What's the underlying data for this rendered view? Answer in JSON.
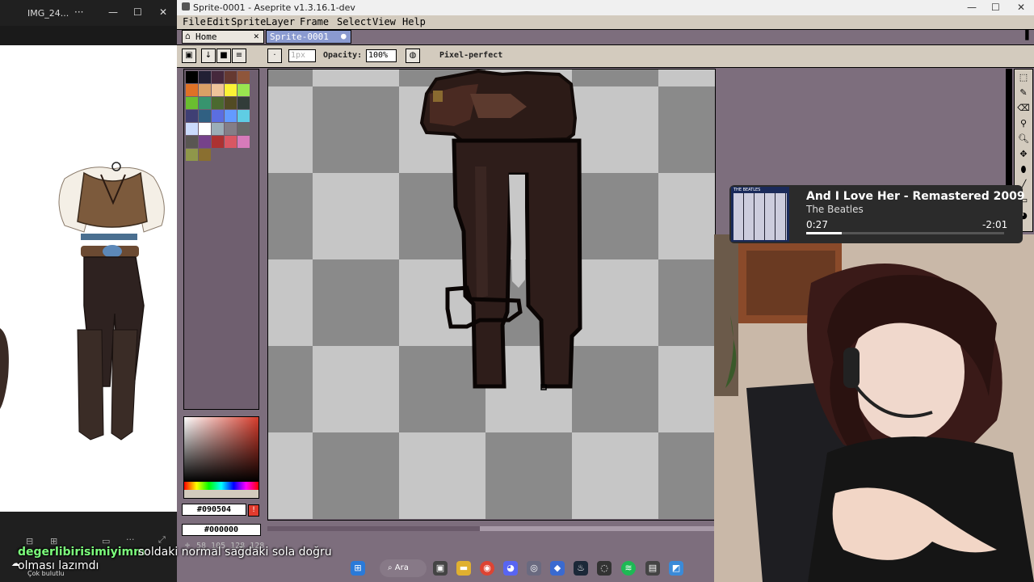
{
  "viewer": {
    "title": "IMG_24...",
    "more": "···",
    "minimize": "—",
    "maximize": "☐",
    "close": "✕"
  },
  "aseprite": {
    "window_title": "Sprite-0001 - Aseprite v1.3.16.1-dev",
    "menu": [
      "File",
      "Edit",
      "Sprite",
      "Layer",
      "Frame",
      "Select",
      "View",
      "Help"
    ],
    "tabs": {
      "home": "Home",
      "sprite": "Sprite-0001"
    },
    "toolbar": {
      "opacity_label": "Opacity:",
      "opacity_value": "100%",
      "brush_size": "1px",
      "pixel_perfect": "Pixel-perfect"
    },
    "palette_colors": [
      "#000000",
      "#222034",
      "#45283c",
      "#663931",
      "#8f563b",
      "#df7126",
      "#d9a066",
      "#eec39a",
      "#fbf236",
      "#99e550",
      "#6abe30",
      "#37946e",
      "#4b692f",
      "#524b24",
      "#323c39",
      "#3f3f74",
      "#306082",
      "#5b6ee1",
      "#639bff",
      "#5fcde4",
      "#cbdbfc",
      "#ffffff",
      "#9badb7",
      "#847e87",
      "#696a6a",
      "#595652",
      "#76428a",
      "#ac3232",
      "#d95763",
      "#d77bba",
      "#8f974a",
      "#8a6f30"
    ],
    "fg_hex": "#090504",
    "bg_hex": "#000000",
    "status": "58 105 128 128",
    "colors": {
      "ui_bg": "#7d6e7d",
      "ui_panel": "#d3cbbe",
      "checker_light": "#c6c6c6",
      "checker_dark": "#8a8a8a"
    }
  },
  "media": {
    "title": "And I Love Her - Remastered 2009",
    "artist": "The Beatles",
    "elapsed": "0:27",
    "remaining": "-2:01",
    "album_label": "THE BEATLES",
    "progress": 0.18
  },
  "chat": {
    "user": "degerlibirisimiyimm",
    "message_part1": "soldaki normal sağdaki sola doğru",
    "message_part2": "olması lazımdı",
    "badge_text": "Çok bulutlu"
  },
  "taskbar": {
    "search_label": "Ara"
  }
}
